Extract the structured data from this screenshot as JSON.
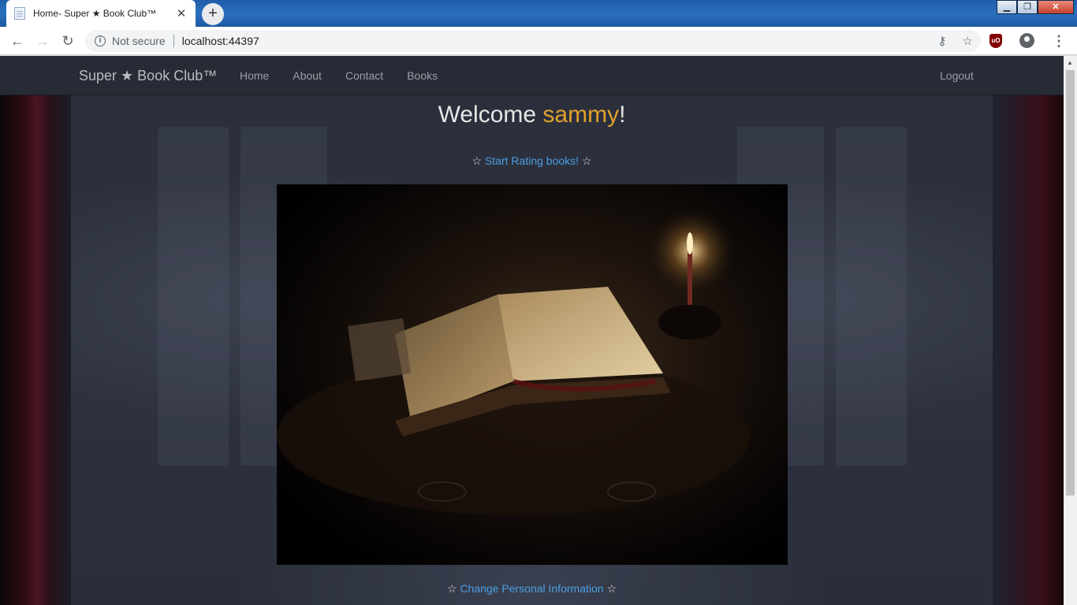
{
  "browser": {
    "tab_title": "Home- Super ★ Book Club™",
    "security_label": "Not secure",
    "url": "localhost:44397"
  },
  "navbar": {
    "brand": "Super ★ Book Club™",
    "links": [
      "Home",
      "About",
      "Contact",
      "Books"
    ],
    "logout": "Logout"
  },
  "main": {
    "welcome_prefix": "Welcome ",
    "username": "sammy",
    "welcome_suffix": "!",
    "star": "☆",
    "start_rating_link": "Start Rating books!",
    "change_info_link": "Change Personal Information"
  },
  "colors": {
    "navbar_bg": "#272b35",
    "username": "#e0a12c",
    "link": "#4a9fe3"
  }
}
